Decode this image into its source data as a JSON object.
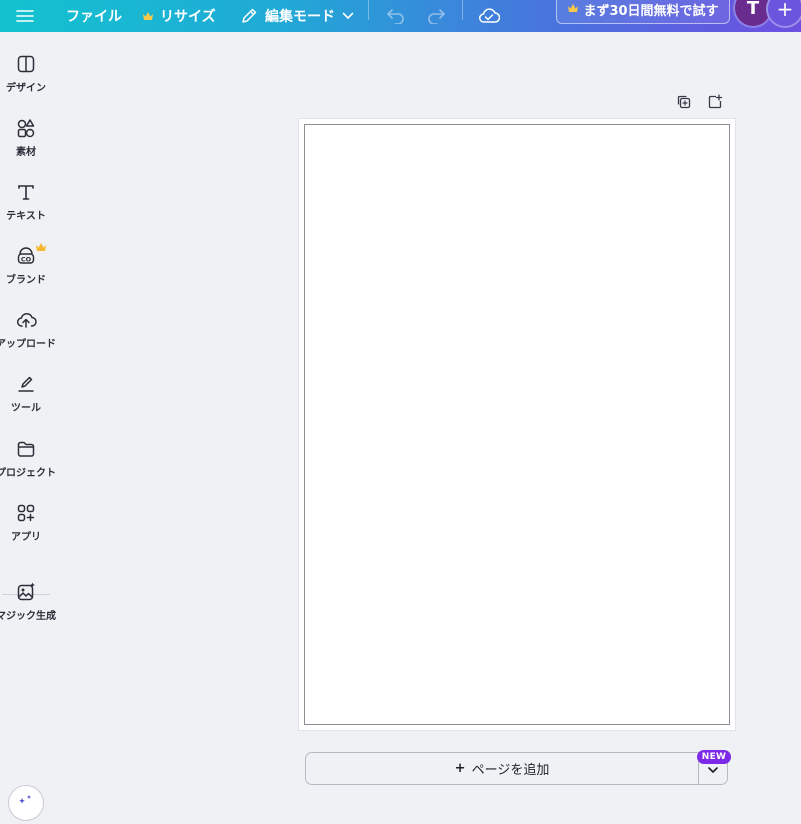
{
  "topbar": {
    "file_label": "ファイル",
    "resize_label": "リサイズ",
    "edit_mode_label": "編集モード",
    "trial_label": "まず30日間無料で試す",
    "avatar_initial": "T",
    "plus_symbol": "+",
    "icons": {
      "menu": "hamburger-menu-icon",
      "resize_crown": "crown-icon",
      "edit": "pencil-icon",
      "edit_chevron": "chevron-down-icon",
      "undo": "undo-icon",
      "redo": "redo-icon",
      "save_status": "cloud-check-icon",
      "trial_crown": "crown-icon"
    }
  },
  "sidebar": {
    "items": [
      {
        "label": "デザイン",
        "icon": "design-layout-icon"
      },
      {
        "label": "素材",
        "icon": "shapes-icon"
      },
      {
        "label": "テキスト",
        "icon": "text-icon"
      },
      {
        "label": "ブランド",
        "icon": "brand-kit-icon",
        "premium": true
      },
      {
        "label": "アップロード",
        "icon": "cloud-upload-icon"
      },
      {
        "label": "ツール",
        "icon": "draw-tool-icon"
      },
      {
        "label": "プロジェクト",
        "icon": "folder-icon"
      },
      {
        "label": "アプリ",
        "icon": "apps-icon"
      },
      {
        "label": "マジック生成",
        "icon": "magic-media-icon"
      }
    ]
  },
  "canvas": {
    "page_tools": [
      "duplicate-page-icon",
      "add-page-icon"
    ],
    "add_page_label": "ページを追加",
    "add_page_symbol": "+",
    "new_badge": "NEW"
  },
  "colors": {
    "topbar_gradient_start": "#13c3cf",
    "topbar_gradient_end": "#6d4fe0",
    "avatar_bg": "#6a2b8e",
    "new_badge_bg": "#7d2ae8",
    "crown": "#f7b731",
    "workspace_bg": "#f0f1f5"
  }
}
